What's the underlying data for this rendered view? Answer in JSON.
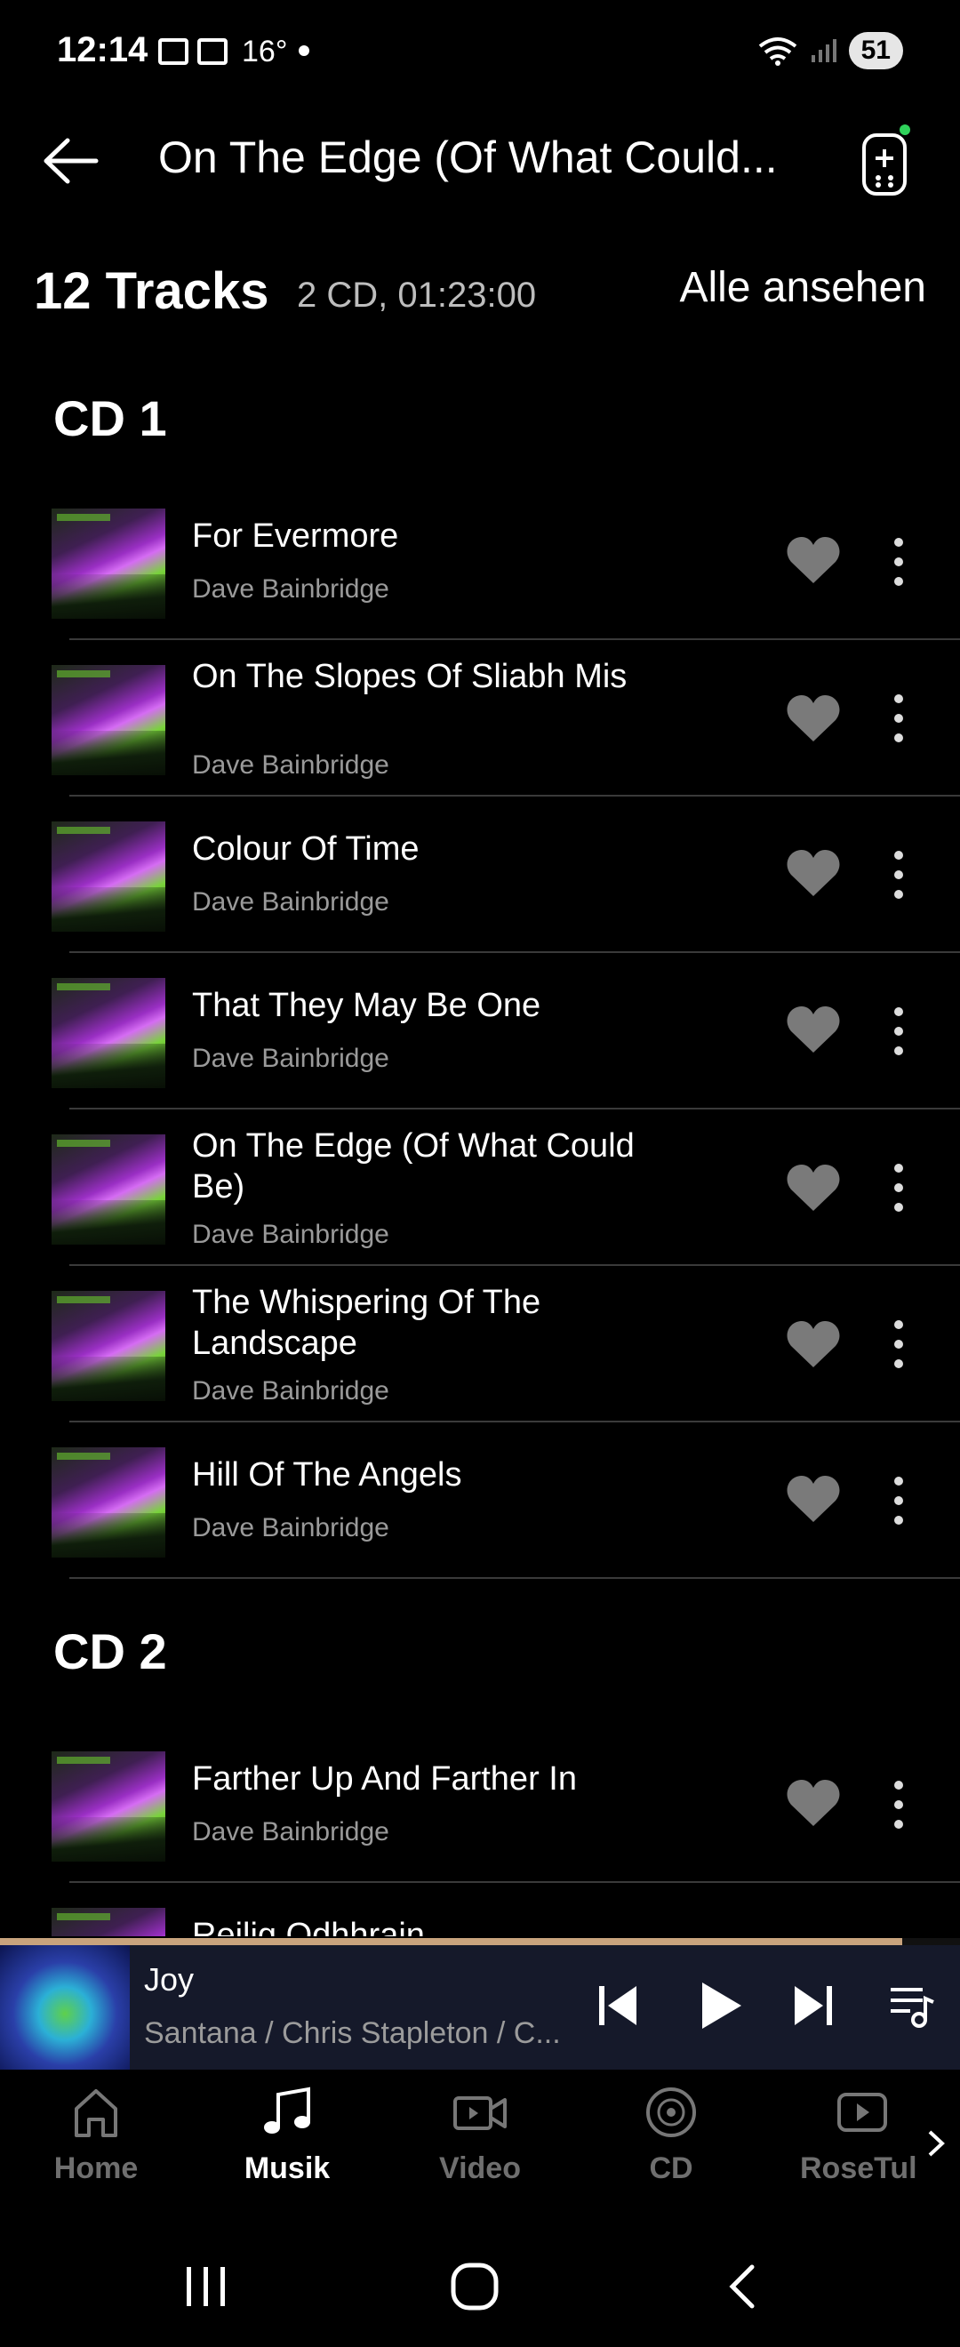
{
  "status_bar": {
    "time": "12:14",
    "temperature": "16°",
    "battery": "51"
  },
  "header": {
    "title": "On The Edge (Of What Could..."
  },
  "summary": {
    "track_count": "12 Tracks",
    "meta": "2 CD, 01:23:00",
    "see_all": "Alle ansehen"
  },
  "cd1": {
    "heading": "CD 1",
    "tracks": [
      {
        "title": "For Evermore",
        "artist": "Dave Bainbridge"
      },
      {
        "title": "On The Slopes Of Sliabh Mis",
        "artist": "Dave Bainbridge"
      },
      {
        "title": "Colour Of Time",
        "artist": "Dave Bainbridge"
      },
      {
        "title": "That They May Be One",
        "artist": "Dave Bainbridge"
      },
      {
        "title": "On The Edge (Of What Could Be)",
        "artist": "Dave Bainbridge"
      },
      {
        "title": "The Whispering Of The Landscape",
        "artist": "Dave Bainbridge"
      },
      {
        "title": "Hill Of The Angels",
        "artist": "Dave Bainbridge"
      }
    ]
  },
  "cd2": {
    "heading": "CD 2",
    "tracks": [
      {
        "title": "Farther Up And Farther In",
        "artist": "Dave Bainbridge"
      },
      {
        "title": "Reilig Odhhrain",
        "artist": ""
      }
    ]
  },
  "player": {
    "song": "Joy",
    "artists": "Santana / Chris Stapleton / C...",
    "progress": 0.94
  },
  "nav": {
    "items": [
      {
        "label": "Home",
        "icon": "home-icon"
      },
      {
        "label": "Musik",
        "icon": "music-note-icon"
      },
      {
        "label": "Video",
        "icon": "video-camera-icon"
      },
      {
        "label": "CD",
        "icon": "cd-icon"
      },
      {
        "label": "RoseTul",
        "icon": "play-box-icon"
      }
    ],
    "active": "Musik"
  },
  "colors": {
    "background": "#000000",
    "secondary_text": "#9a9a9a",
    "heart": "#7a7a7a",
    "progress": "#c8a37d",
    "player_bg": "#15192a"
  }
}
